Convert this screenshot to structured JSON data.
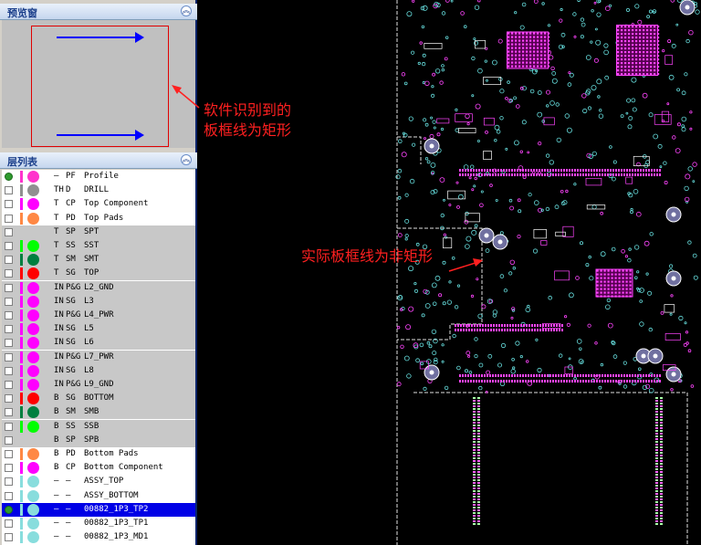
{
  "preview_panel": {
    "title": "预览窗",
    "collapse_icon": "double-chevron-up-icon"
  },
  "layer_panel": {
    "title": "层列表",
    "collapse_icon": "double-chevron-up-icon"
  },
  "layers": [
    {
      "c1": "—",
      "c2": "PF",
      "name": "Profile",
      "color": "#ff33cc",
      "bar": "#ff33cc",
      "checked": true,
      "bg": "white"
    },
    {
      "c1": "TH",
      "c2": "D",
      "name": "DRILL",
      "color": "#909090",
      "bar": "#909090",
      "checked": false,
      "bg": "white"
    },
    {
      "c1": "T",
      "c2": "CP",
      "name": "Top Component",
      "color": "#ff00ff",
      "bar": "#ff00ff",
      "checked": false,
      "bg": "white"
    },
    {
      "c1": "T",
      "c2": "PD",
      "name": "Top Pads",
      "color": "#ff8844",
      "bar": "#ff8844",
      "checked": false,
      "bg": "white"
    },
    {
      "c1": "T",
      "c2": "SP",
      "name": "SPT",
      "color": "#c8c8c8",
      "bar": "#c8c8c8",
      "checked": false,
      "bg": "gray"
    },
    {
      "c1": "T",
      "c2": "SS",
      "name": "SST",
      "color": "#00ff00",
      "bar": "#00ff00",
      "checked": false,
      "bg": "gray"
    },
    {
      "c1": "T",
      "c2": "SM",
      "name": "SMT",
      "color": "#007f3f",
      "bar": "#007f3f",
      "checked": false,
      "bg": "gray"
    },
    {
      "c1": "T",
      "c2": "SG",
      "name": "TOP",
      "color": "#ff0000",
      "bar": "#ff0000",
      "checked": false,
      "bg": "gray"
    },
    {
      "c1": "IN",
      "c2": "P&G",
      "name": "L2_GND",
      "color": "#ff00ff",
      "bar": "#ff00ff",
      "checked": false,
      "bg": "gray"
    },
    {
      "c1": "IN",
      "c2": "SG",
      "name": "L3",
      "color": "#ff00ff",
      "bar": "#ff00ff",
      "checked": false,
      "bg": "gray"
    },
    {
      "c1": "IN",
      "c2": "P&G",
      "name": "L4_PWR",
      "color": "#ff00ff",
      "bar": "#ff00ff",
      "checked": false,
      "bg": "gray"
    },
    {
      "c1": "IN",
      "c2": "SG",
      "name": "L5",
      "color": "#ff00ff",
      "bar": "#ff00ff",
      "checked": false,
      "bg": "gray"
    },
    {
      "c1": "IN",
      "c2": "SG",
      "name": "L6",
      "color": "#ff00ff",
      "bar": "#ff00ff",
      "checked": false,
      "bg": "gray"
    },
    {
      "c1": "IN",
      "c2": "P&G",
      "name": "L7_PWR",
      "color": "#ff00ff",
      "bar": "#ff00ff",
      "checked": false,
      "bg": "gray"
    },
    {
      "c1": "IN",
      "c2": "SG",
      "name": "L8",
      "color": "#ff00ff",
      "bar": "#ff00ff",
      "checked": false,
      "bg": "gray"
    },
    {
      "c1": "IN",
      "c2": "P&G",
      "name": "L9_GND",
      "color": "#ff00ff",
      "bar": "#ff00ff",
      "checked": false,
      "bg": "gray"
    },
    {
      "c1": "B",
      "c2": "SG",
      "name": "BOTTOM",
      "color": "#ff0000",
      "bar": "#ff0000",
      "checked": false,
      "bg": "gray"
    },
    {
      "c1": "B",
      "c2": "SM",
      "name": "SMB",
      "color": "#007f3f",
      "bar": "#007f3f",
      "checked": false,
      "bg": "gray"
    },
    {
      "c1": "B",
      "c2": "SS",
      "name": "SSB",
      "color": "#00ff00",
      "bar": "#00ff00",
      "checked": false,
      "bg": "gray"
    },
    {
      "c1": "B",
      "c2": "SP",
      "name": "SPB",
      "color": "#c8c8c8",
      "bar": "#c8c8c8",
      "checked": false,
      "bg": "gray"
    },
    {
      "c1": "B",
      "c2": "PD",
      "name": "Bottom Pads",
      "color": "#ff8844",
      "bar": "#ff8844",
      "checked": false,
      "bg": "white"
    },
    {
      "c1": "B",
      "c2": "CP",
      "name": "Bottom Component",
      "color": "#ff00ff",
      "bar": "#ff00ff",
      "checked": false,
      "bg": "white"
    },
    {
      "c1": "—",
      "c2": "—",
      "name": "ASSY_TOP",
      "color": "#88dddd",
      "bar": "#88dddd",
      "checked": false,
      "bg": "white"
    },
    {
      "c1": "—",
      "c2": "—",
      "name": "ASSY_BOTTOM",
      "color": "#88dddd",
      "bar": "#88dddd",
      "checked": false,
      "bg": "white"
    },
    {
      "c1": "—",
      "c2": "—",
      "name": "00882_1P3_TP2",
      "color": "#88dddd",
      "bar": "#88dddd",
      "checked": true,
      "bg": "selected"
    },
    {
      "c1": "—",
      "c2": "—",
      "name": "00882_1P3_TP1",
      "color": "#88dddd",
      "bar": "#88dddd",
      "checked": false,
      "bg": "white"
    },
    {
      "c1": "—",
      "c2": "—",
      "name": "00882_1P3_MD1",
      "color": "#88dddd",
      "bar": "#88dddd",
      "checked": false,
      "bg": "white"
    }
  ],
  "annotations": {
    "software_outline": [
      "软件识别到的",
      "板框线为矩形"
    ],
    "actual_outline": "实际板框线为非矩形"
  },
  "colors": {
    "annotation_red": "#ff2020",
    "preview_arrow": "#0000ff",
    "preview_rect": "#e00000",
    "pcb_trace": "#ff44ff",
    "pcb_via": "#66dddd",
    "pcb_outline": "#e0e0e0"
  }
}
